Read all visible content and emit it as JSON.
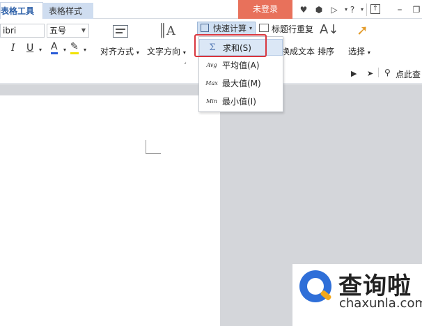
{
  "tabs": {
    "table_tools": "表格工具",
    "table_style": "表格样式"
  },
  "top_right": {
    "login": "未登录",
    "help": "?"
  },
  "ribbon": {
    "font_name": "ibri",
    "font_size": "五号",
    "align_label": "对齐方式",
    "text_dir_label": "文字方向",
    "quick_calc_label": "快速计算",
    "title_repeat_label": "标题行重复",
    "to_text_label": "换成文本",
    "sort_label": "排序",
    "select_label": "选择",
    "search_label": "点此查"
  },
  "menu": {
    "items": [
      {
        "icon": "Σ",
        "label": "求和(S)"
      },
      {
        "icon": "Avg",
        "label": "平均值(A)"
      },
      {
        "icon": "Max",
        "label": "最大值(M)"
      },
      {
        "icon": "Min",
        "label": "最小值(I)"
      }
    ]
  },
  "watermark": {
    "title": "查询啦",
    "url": "chaxunla.com"
  },
  "colors": {
    "accent": "#2c5fa8",
    "login_bg": "#e8715b",
    "highlight_border": "#d9363e",
    "doc_bg": "#d4d6da"
  }
}
